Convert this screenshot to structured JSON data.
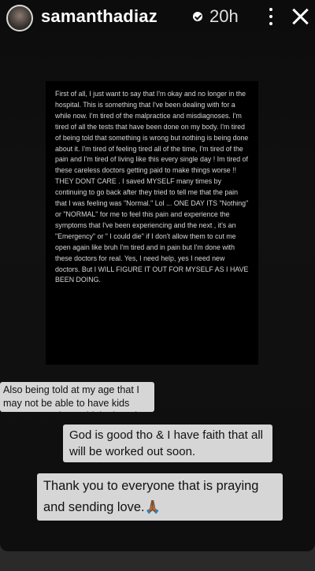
{
  "header": {
    "username": "samanthadiaz",
    "time": "20h",
    "verified_icon": "verified-badge-icon",
    "more_icon": "more-vertical-icon",
    "close_icon": "close-icon"
  },
  "statement": {
    "text": "First of all, I just want to say that I'm okay and no longer in the hospital. This is something that I've been dealing with for a while now.  I'm tired of the malpractice and misdiagnoses. I'm tired of all the tests that have been done on my body. I'm tired of being told that something is wrong but nothing is being done about it. I'm tired of feeling tired all of the time, I'm tired of the pain and I'm tired of living like this every single day ! Im tired of these careless doctors getting paid to make things worse !! THEY DONT CARE . I saved MYSELF many times by continuing to go back after they tried to tell me that the pain that I was feeling was \"Normal.\" Lol ... ONE DAY ITS \"Nothing\" or \"NORMAL\" for me to feel this pain and experience the symptoms that I've been experiencing and the next , it's an \"Emergency\" or \" I could die\" if I don't allow them to cut me open again like bruh I'm tired and in pain but I'm done with these doctors for real. Yes, I need help, yes I need new doctors. But I WILL FIGURE IT OUT FOR MYSELF AS I HAVE BEEN DOING."
  },
  "captions": [
    {
      "text": "Also being told at my age that I may not be able to have kids scares me when I think about it."
    },
    {
      "text": "God is good tho & I have faith that all will be worked out soon."
    },
    {
      "text": "Thank you to everyone that is praying and sending love.🙏🏾"
    }
  ],
  "colors": {
    "background": "#0c0c0c",
    "caption_bg": "#ececec",
    "statement_bg": "#000000"
  }
}
